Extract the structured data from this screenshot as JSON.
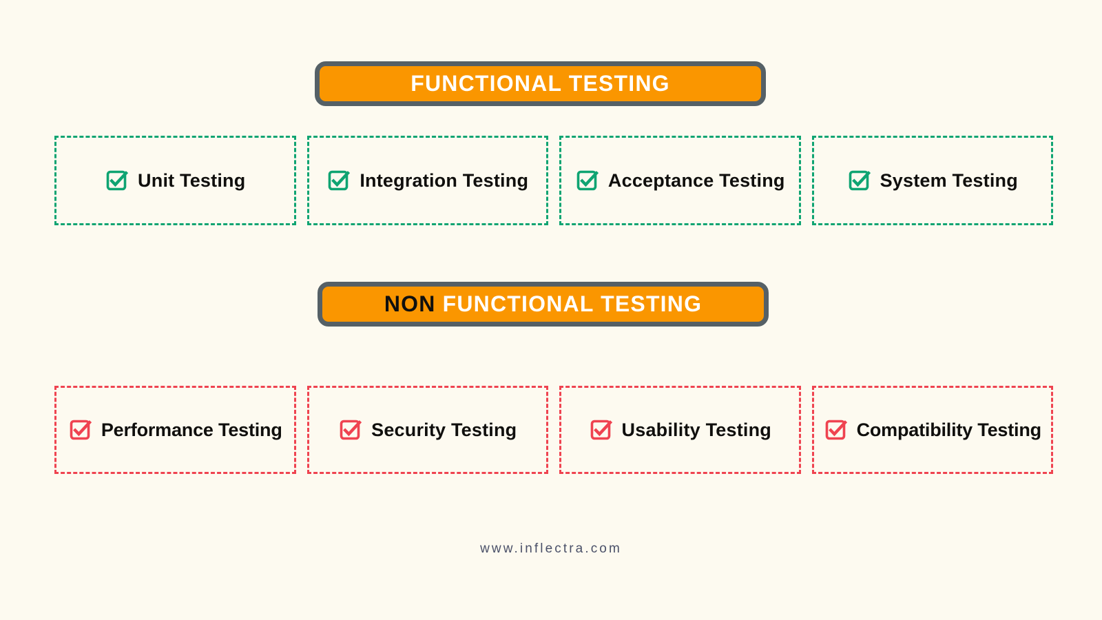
{
  "background_color": "#FDFAF0",
  "banners": [
    {
      "id": "functional",
      "prefix": "",
      "label": "FUNCTIONAL TESTING",
      "fill_color": "#FA9600",
      "border_color": "#556066",
      "text_color": "#FFFFFF"
    },
    {
      "id": "non-functional",
      "prefix": "NON",
      "label": "FUNCTIONAL TESTING",
      "fill_color": "#FA9600",
      "border_color": "#556066",
      "text_color": "#FFFFFF",
      "prefix_color": "#10100F"
    }
  ],
  "functional_row": {
    "accent_color": "#0FA472",
    "icon": "checkbox-checked-icon",
    "items": [
      {
        "label": "Unit Testing"
      },
      {
        "label": "Integration Testing"
      },
      {
        "label": "Acceptance Testing"
      },
      {
        "label": "System Testing"
      }
    ]
  },
  "non_functional_row": {
    "accent_color": "#EF4350",
    "icon": "checkbox-checked-icon",
    "items": [
      {
        "label": "Performance Testing"
      },
      {
        "label": "Security Testing"
      },
      {
        "label": "Usability Testing"
      },
      {
        "label": "Compatibility Testing"
      }
    ]
  },
  "footer": {
    "url": "www.inflectra.com",
    "color": "#4A5068"
  }
}
